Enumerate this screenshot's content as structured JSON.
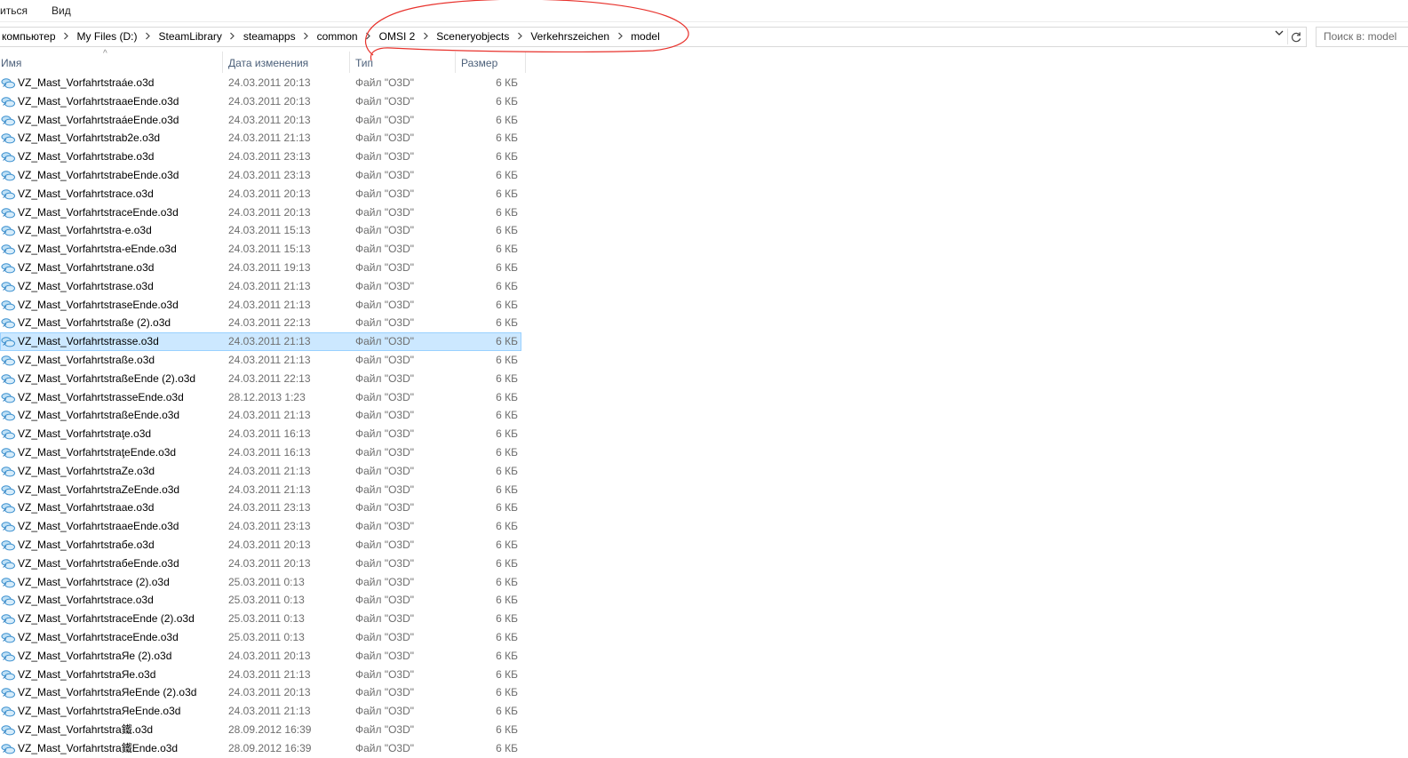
{
  "menu": {
    "item1": "иться",
    "item2": "Вид"
  },
  "address": {
    "crumbs": [
      "компьютер",
      "My Files (D:)",
      "SteamLibrary",
      "steamapps",
      "common",
      "OMSI 2",
      "Sceneryobjects",
      "Verkehrszeichen",
      "model"
    ],
    "dropdown_icon": "chevron-down-icon",
    "refresh_icon": "refresh-icon"
  },
  "search": {
    "placeholder": "Поиск в: model"
  },
  "columns": {
    "name": "Имя",
    "date": "Дата изменения",
    "type": "Тип",
    "size": "Размер"
  },
  "annotation_color": "#e8322c",
  "selection_color": "#cce8ff",
  "files": [
    {
      "name": "VZ_Mast_Vorfahrtstraáe.o3d",
      "date": "24.03.2011 20:13",
      "type": "Файл \"O3D\"",
      "size": "6 КБ"
    },
    {
      "name": "VZ_Mast_VorfahrtstraaeEnde.o3d",
      "date": "24.03.2011 20:13",
      "type": "Файл \"O3D\"",
      "size": "6 КБ"
    },
    {
      "name": "VZ_Mast_VorfahrtstraáeEnde.o3d",
      "date": "24.03.2011 20:13",
      "type": "Файл \"O3D\"",
      "size": "6 КБ"
    },
    {
      "name": "VZ_Mast_Vorfahrtstrab2e.o3d",
      "date": "24.03.2011 21:13",
      "type": "Файл \"O3D\"",
      "size": "6 КБ"
    },
    {
      "name": "VZ_Mast_Vorfahrtstrabe.o3d",
      "date": "24.03.2011 23:13",
      "type": "Файл \"O3D\"",
      "size": "6 КБ"
    },
    {
      "name": "VZ_Mast_VorfahrtstrabeEnde.o3d",
      "date": "24.03.2011 23:13",
      "type": "Файл \"O3D\"",
      "size": "6 КБ"
    },
    {
      "name": "VZ_Mast_Vorfahrtstrace.o3d",
      "date": "24.03.2011 20:13",
      "type": "Файл \"O3D\"",
      "size": "6 КБ"
    },
    {
      "name": "VZ_Mast_VorfahrtstraceEnde.o3d",
      "date": "24.03.2011 20:13",
      "type": "Файл \"O3D\"",
      "size": "6 КБ"
    },
    {
      "name": "VZ_Mast_Vorfahrtstra-e.o3d",
      "date": "24.03.2011 15:13",
      "type": "Файл \"O3D\"",
      "size": "6 КБ"
    },
    {
      "name": "VZ_Mast_Vorfahrtstra-eEnde.o3d",
      "date": "24.03.2011 15:13",
      "type": "Файл \"O3D\"",
      "size": "6 КБ"
    },
    {
      "name": "VZ_Mast_Vorfahrtstrane.o3d",
      "date": "24.03.2011 19:13",
      "type": "Файл \"O3D\"",
      "size": "6 КБ"
    },
    {
      "name": "VZ_Mast_Vorfahrtstrase.o3d",
      "date": "24.03.2011 21:13",
      "type": "Файл \"O3D\"",
      "size": "6 КБ"
    },
    {
      "name": "VZ_Mast_VorfahrtstraseEnde.o3d",
      "date": "24.03.2011 21:13",
      "type": "Файл \"O3D\"",
      "size": "6 КБ"
    },
    {
      "name": "VZ_Mast_Vorfahrtstraße (2).o3d",
      "date": "24.03.2011 22:13",
      "type": "Файл \"O3D\"",
      "size": "6 КБ"
    },
    {
      "name": "VZ_Mast_Vorfahrtstrasse.o3d",
      "date": "24.03.2011 21:13",
      "type": "Файл \"O3D\"",
      "size": "6 КБ",
      "selected": true
    },
    {
      "name": "VZ_Mast_Vorfahrtstraße.o3d",
      "date": "24.03.2011 21:13",
      "type": "Файл \"O3D\"",
      "size": "6 КБ"
    },
    {
      "name": "VZ_Mast_VorfahrtstraßeEnde (2).o3d",
      "date": "24.03.2011 22:13",
      "type": "Файл \"O3D\"",
      "size": "6 КБ"
    },
    {
      "name": "VZ_Mast_VorfahrtstrasseEnde.o3d",
      "date": "28.12.2013 1:23",
      "type": "Файл \"O3D\"",
      "size": "6 КБ"
    },
    {
      "name": "VZ_Mast_VorfahrtstraßeEnde.o3d",
      "date": "24.03.2011 21:13",
      "type": "Файл \"O3D\"",
      "size": "6 КБ"
    },
    {
      "name": "VZ_Mast_Vorfahrtstraţe.o3d",
      "date": "24.03.2011 16:13",
      "type": "Файл \"O3D\"",
      "size": "6 КБ"
    },
    {
      "name": "VZ_Mast_VorfahrtstraţeEnde.o3d",
      "date": "24.03.2011 16:13",
      "type": "Файл \"O3D\"",
      "size": "6 КБ"
    },
    {
      "name": "VZ_Mast_VorfahrtstraZe.o3d",
      "date": "24.03.2011 21:13",
      "type": "Файл \"O3D\"",
      "size": "6 КБ"
    },
    {
      "name": "VZ_Mast_VorfahrtstraZeEnde.o3d",
      "date": "24.03.2011 21:13",
      "type": "Файл \"O3D\"",
      "size": "6 КБ"
    },
    {
      "name": "VZ_Mast_Vorfahrtstraae.o3d",
      "date": "24.03.2011 23:13",
      "type": "Файл \"O3D\"",
      "size": "6 КБ"
    },
    {
      "name": "VZ_Mast_VorfahrtstraaeEnde.o3d",
      "date": "24.03.2011 23:13",
      "type": "Файл \"O3D\"",
      "size": "6 КБ"
    },
    {
      "name": "VZ_Mast_Vorfahrtstraбe.o3d",
      "date": "24.03.2011 20:13",
      "type": "Файл \"O3D\"",
      "size": "6 КБ"
    },
    {
      "name": "VZ_Mast_VorfahrtstraбeEnde.o3d",
      "date": "24.03.2011 20:13",
      "type": "Файл \"O3D\"",
      "size": "6 КБ"
    },
    {
      "name": "VZ_Mast_Vorfahrtstrace (2).o3d",
      "date": "25.03.2011 0:13",
      "type": "Файл \"O3D\"",
      "size": "6 КБ"
    },
    {
      "name": "VZ_Mast_Vorfahrtstrace.o3d",
      "date": "25.03.2011 0:13",
      "type": "Файл \"O3D\"",
      "size": "6 КБ"
    },
    {
      "name": "VZ_Mast_VorfahrtstraceEnde (2).o3d",
      "date": "25.03.2011 0:13",
      "type": "Файл \"O3D\"",
      "size": "6 КБ"
    },
    {
      "name": "VZ_Mast_VorfahrtstraceEnde.o3d",
      "date": "25.03.2011 0:13",
      "type": "Файл \"O3D\"",
      "size": "6 КБ"
    },
    {
      "name": "VZ_Mast_VorfahrtstraЯe (2).o3d",
      "date": "24.03.2011 20:13",
      "type": "Файл \"O3D\"",
      "size": "6 КБ"
    },
    {
      "name": "VZ_Mast_VorfahrtstraЯe.o3d",
      "date": "24.03.2011 21:13",
      "type": "Файл \"O3D\"",
      "size": "6 КБ"
    },
    {
      "name": "VZ_Mast_VorfahrtstraЯeEnde (2).o3d",
      "date": "24.03.2011 20:13",
      "type": "Файл \"O3D\"",
      "size": "6 КБ"
    },
    {
      "name": "VZ_Mast_VorfahrtstraЯeEnde.o3d",
      "date": "24.03.2011 21:13",
      "type": "Файл \"O3D\"",
      "size": "6 КБ"
    },
    {
      "name": "VZ_Mast_Vorfahrtstra鐵.o3d",
      "date": "28.09.2012 16:39",
      "type": "Файл \"O3D\"",
      "size": "6 КБ"
    },
    {
      "name": "VZ_Mast_Vorfahrtstra鐵Ende.o3d",
      "date": "28.09.2012 16:39",
      "type": "Файл \"O3D\"",
      "size": "6 КБ"
    }
  ]
}
